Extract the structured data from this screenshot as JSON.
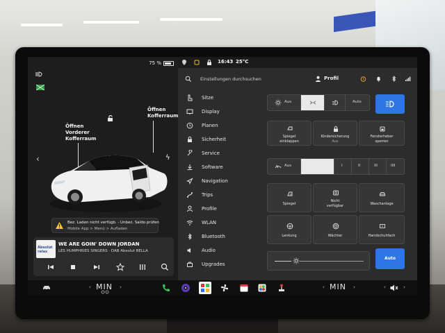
{
  "left": {
    "battery_pct": "75 %",
    "trunk_front": [
      "Öffnen",
      "Vorderer",
      "Kofferraum"
    ],
    "trunk_rear": [
      "Öffnen",
      "Kofferraum"
    ],
    "warning": {
      "line1": "Bez. Laden nicht verfügb. - Unbez. Saldo prüfen",
      "line2": "Mobile App > Menü > Aufladen"
    },
    "media": {
      "art_text": "Absolut relax",
      "title": "WE ARE GOIN' DOWN JORDAN",
      "subtitle": "LES HUMPHRIES SINGERS · DAB Absolut BELLA"
    }
  },
  "status": {
    "time": "16:43",
    "temp": "25°C"
  },
  "header": {
    "search_placeholder": "Einstellungen durchsuchen",
    "profile_label": "Profil"
  },
  "menu": [
    {
      "label": "Sitze",
      "icon": "seat-icon"
    },
    {
      "label": "Display",
      "icon": "display-icon"
    },
    {
      "label": "Planen",
      "icon": "clock-icon"
    },
    {
      "label": "Sicherheit",
      "icon": "lock-icon"
    },
    {
      "label": "Service",
      "icon": "wrench-icon"
    },
    {
      "label": "Software",
      "icon": "download-icon"
    },
    {
      "label": "Navigation",
      "icon": "navigation-icon"
    },
    {
      "label": "Trips",
      "icon": "trips-icon"
    },
    {
      "label": "Profile",
      "icon": "person-icon"
    },
    {
      "label": "WLAN",
      "icon": "wifi-icon"
    },
    {
      "label": "Bluetooth",
      "icon": "bluetooth-icon"
    },
    {
      "label": "Audio",
      "icon": "speaker-icon"
    },
    {
      "label": "Upgrades",
      "icon": "upgrades-icon"
    }
  ],
  "lights": {
    "off": "Aus",
    "auto": "Auto"
  },
  "row2": {
    "mirror": [
      "Spiegel",
      "einklappen"
    ],
    "child_lock": [
      "Kindersicherung",
      "Aus"
    ],
    "window_lock": [
      "Fensterheber",
      "sperren"
    ]
  },
  "wipers": {
    "off": "Aus",
    "levels": [
      "I",
      "II",
      "III",
      "IIII"
    ]
  },
  "tiles": {
    "mirror": "Spiegel",
    "unavailable": [
      "Nicht",
      "verfügbar"
    ],
    "car_wash": "Waschanlage",
    "steering": "Lenkung",
    "dashcam": "Wächter",
    "glovebox": "Handschuhfach"
  },
  "brightness": {
    "auto": "Auto"
  },
  "dock": {
    "left_temp": "MIN",
    "right_temp": "MIN"
  },
  "colors": {
    "accent_blue": "#2e76e6",
    "panel_dark": "#1d1d1d",
    "panel_mid": "#2c2c2c"
  }
}
